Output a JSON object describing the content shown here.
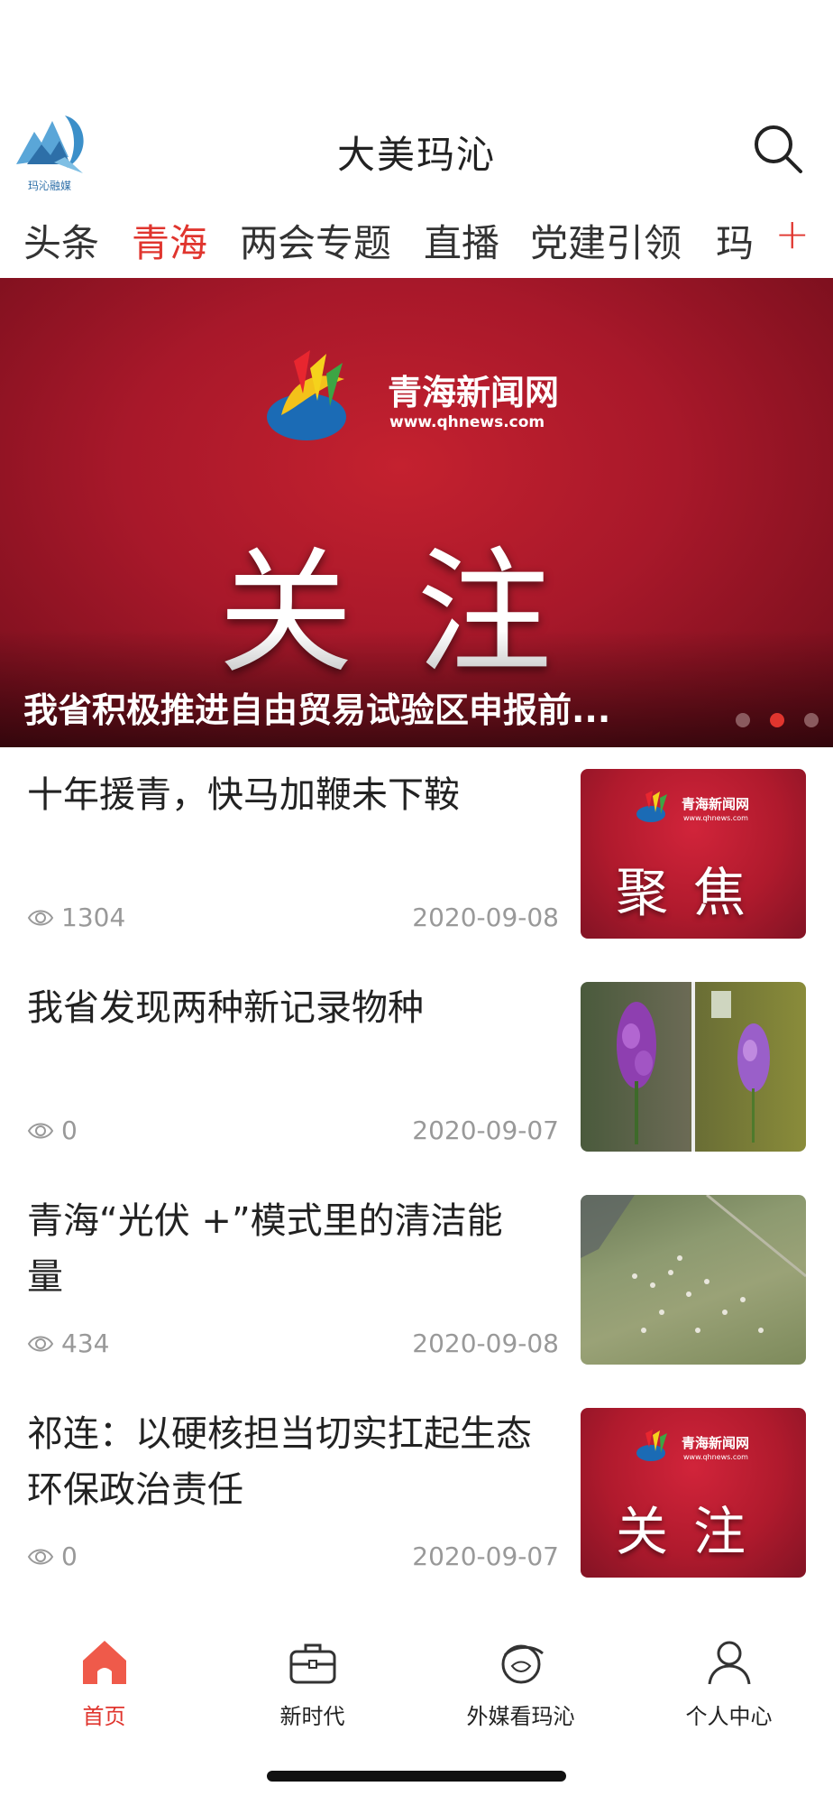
{
  "header": {
    "logo_text": "玛沁融媒",
    "title": "大美玛沁",
    "search_icon": "search-icon"
  },
  "tabs": {
    "items": [
      {
        "label": "头条",
        "active": false
      },
      {
        "label": "青海",
        "active": true
      },
      {
        "label": "两会专题",
        "active": false
      },
      {
        "label": "直播",
        "active": false
      },
      {
        "label": "党建引领",
        "active": false
      },
      {
        "label": "玛",
        "active": false
      }
    ],
    "add_label": "+"
  },
  "banner": {
    "brand": "青海新闻网",
    "url": "www.qhnews.com",
    "headline_word": "关注",
    "caption": "我省积极推进自由贸易试验区申报前...",
    "dots": 3,
    "active_dot": 1
  },
  "news": [
    {
      "title": "十年援青，快马加鞭未下鞍",
      "views": "1304",
      "date": "2020-09-08",
      "thumb": {
        "type": "red",
        "brand": "青海新闻网",
        "url": "www.qhnews.com",
        "word": "聚焦"
      }
    },
    {
      "title": "我省发现两种新记录物种",
      "views": "0",
      "date": "2020-09-07",
      "thumb": {
        "type": "flowers"
      }
    },
    {
      "title": "青海“光伏 +”模式里的清洁能量",
      "views": "434",
      "date": "2020-09-08",
      "thumb": {
        "type": "field"
      }
    },
    {
      "title": "祁连：以硬核担当切实扛起生态环保政治责任",
      "views": "0",
      "date": "2020-09-07",
      "thumb": {
        "type": "red",
        "brand": "青海新闻网",
        "url": "www.qhnews.com",
        "word": "关注"
      }
    }
  ],
  "bottom_nav": [
    {
      "label": "首页",
      "icon": "home-icon",
      "active": true
    },
    {
      "label": "新时代",
      "icon": "briefcase-icon",
      "active": false
    },
    {
      "label": "外媒看玛沁",
      "icon": "globe-icon",
      "active": false
    },
    {
      "label": "个人中心",
      "icon": "user-icon",
      "active": false
    }
  ],
  "colors": {
    "accent": "#e0352e",
    "banner_red": "#b01a2d",
    "meta_gray": "#999999"
  }
}
